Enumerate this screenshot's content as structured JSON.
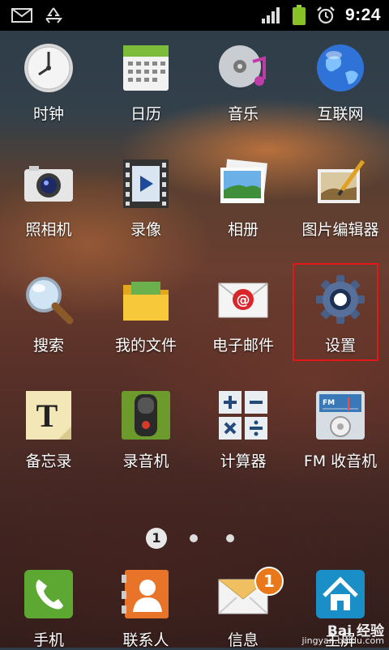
{
  "status_bar": {
    "time": "9:24",
    "left_icons": [
      "mail-icon",
      "recycle-icon"
    ],
    "right_icons": [
      "signal-icon",
      "battery-icon",
      "alarm-icon"
    ]
  },
  "apps": [
    {
      "label": "时钟",
      "icon": "clock-icon"
    },
    {
      "label": "日历",
      "icon": "calendar-icon"
    },
    {
      "label": "音乐",
      "icon": "music-icon"
    },
    {
      "label": "互联网",
      "icon": "globe-icon"
    },
    {
      "label": "照相机",
      "icon": "camera-icon"
    },
    {
      "label": "录像",
      "icon": "video-icon"
    },
    {
      "label": "相册",
      "icon": "gallery-icon"
    },
    {
      "label": "图片编辑器",
      "icon": "photo-editor-icon"
    },
    {
      "label": "搜索",
      "icon": "search-icon"
    },
    {
      "label": "我的文件",
      "icon": "folder-icon"
    },
    {
      "label": "电子邮件",
      "icon": "email-icon"
    },
    {
      "label": "设置",
      "icon": "gear-icon"
    },
    {
      "label": "备忘录",
      "icon": "memo-icon"
    },
    {
      "label": "录音机",
      "icon": "voice-recorder-icon"
    },
    {
      "label": "计算器",
      "icon": "calculator-icon"
    },
    {
      "label": "FM 收音机",
      "icon": "fm-radio-icon"
    }
  ],
  "pager": {
    "current": "1",
    "total_pages": 3
  },
  "dock": [
    {
      "label": "手机",
      "icon": "phone-icon"
    },
    {
      "label": "联系人",
      "icon": "contacts-icon"
    },
    {
      "label": "信息",
      "icon": "message-icon",
      "badge": "1"
    },
    {
      "label": "主屏",
      "icon": "home-icon"
    }
  ],
  "watermark": {
    "line1": "Bai 经验",
    "line2": "jingyan.baidu.com"
  },
  "colors": {
    "highlight": "#e01818"
  }
}
